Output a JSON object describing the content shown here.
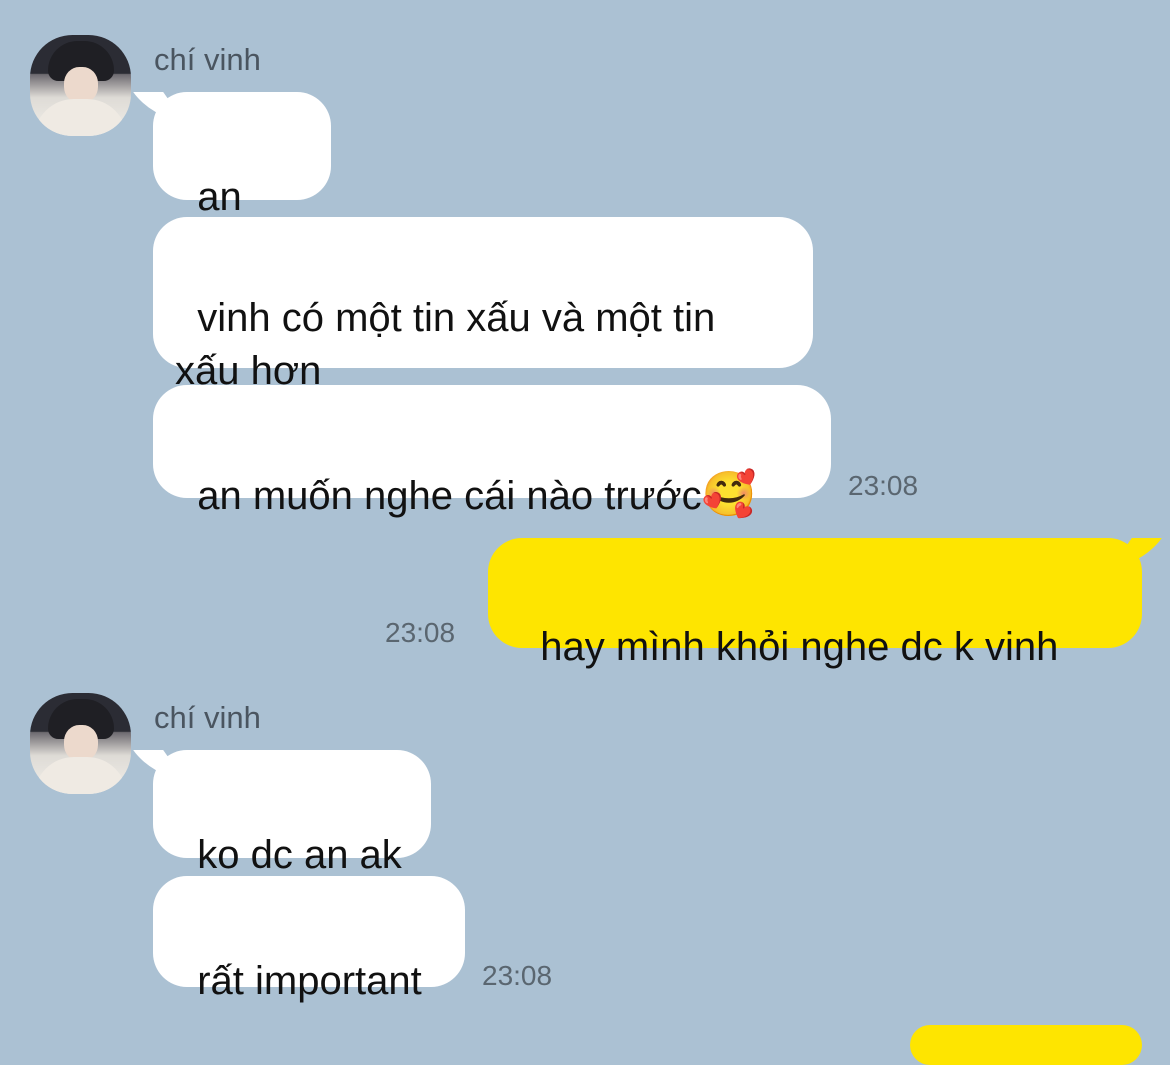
{
  "colors": {
    "chat_background": "#abc1d3",
    "incoming_bubble": "#ffffff",
    "outgoing_bubble": "#fee500"
  },
  "groups": [
    {
      "sender": "chí vinh",
      "messages": [
        "an ơi...",
        "vinh có một tin xấu và một tin\nxấu hơn",
        "an muốn nghe cái nào trước"
      ],
      "emoji": "🥰",
      "time": "23:08"
    },
    {
      "outgoing": true,
      "messages": [
        "hay mình khỏi nghe dc k vinh"
      ],
      "time": "23:08"
    },
    {
      "sender": "chí vinh",
      "messages": [
        "ko dc an ak",
        "rất important"
      ],
      "time": "23:08"
    }
  ]
}
